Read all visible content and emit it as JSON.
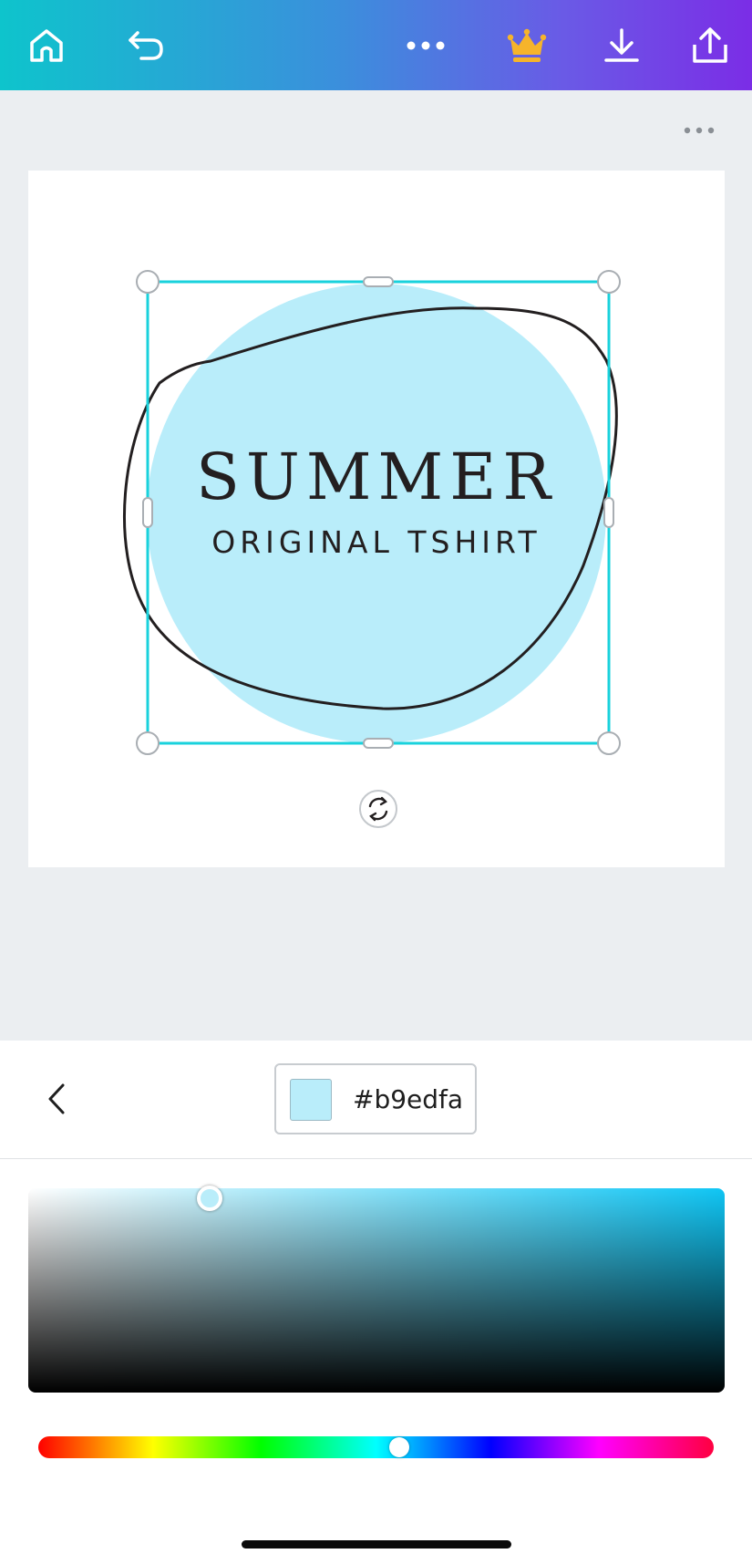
{
  "toolbar": {
    "icons": [
      "home-icon",
      "undo-icon",
      "more-horizontal-icon",
      "crown-icon",
      "download-icon",
      "share-icon"
    ],
    "crown_color": "#f6b42b"
  },
  "workspace": {
    "more_icon": "more-horizontal-icon",
    "background": "#ebeef1"
  },
  "design": {
    "headline": "SUMMER",
    "subline": "ORIGINAL TSHIRT",
    "circle_fill": "#b9edfa",
    "selection_color": "#19d2dc",
    "rotate_icon": "rotate-icon"
  },
  "color_panel": {
    "back_icon": "chevron-left-icon",
    "hex_value": "#b9edfa",
    "swatch_color": "#b9edfa",
    "sv_hue_color": "#10c6f5",
    "hue_value_fraction": 0.53,
    "saturation_fraction": 0.24,
    "brightness_fraction": 0.98
  }
}
